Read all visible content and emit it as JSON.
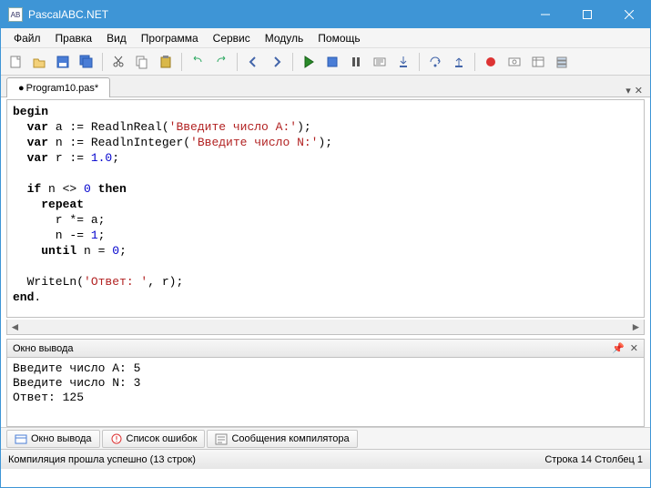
{
  "title": "PascalABC.NET",
  "menu": [
    "Файл",
    "Правка",
    "Вид",
    "Программа",
    "Сервис",
    "Модуль",
    "Помощь"
  ],
  "tab": {
    "label": "Program10.pas*",
    "modified": true
  },
  "code_tokens": [
    [
      {
        "t": "begin",
        "c": "kw"
      }
    ],
    [
      {
        "t": "  "
      },
      {
        "t": "var",
        "c": "kw"
      },
      {
        "t": " a := ReadlnReal("
      },
      {
        "t": "'Введите число A:'",
        "c": "str"
      },
      {
        "t": ");"
      }
    ],
    [
      {
        "t": "  "
      },
      {
        "t": "var",
        "c": "kw"
      },
      {
        "t": " n := ReadlnInteger("
      },
      {
        "t": "'Введите число N:'",
        "c": "str"
      },
      {
        "t": ");"
      }
    ],
    [
      {
        "t": "  "
      },
      {
        "t": "var",
        "c": "kw"
      },
      {
        "t": " r := "
      },
      {
        "t": "1.0",
        "c": "num"
      },
      {
        "t": ";"
      }
    ],
    [
      {
        "t": ""
      }
    ],
    [
      {
        "t": "  "
      },
      {
        "t": "if",
        "c": "kw"
      },
      {
        "t": " n <> "
      },
      {
        "t": "0",
        "c": "num"
      },
      {
        "t": " "
      },
      {
        "t": "then",
        "c": "kw"
      }
    ],
    [
      {
        "t": "    "
      },
      {
        "t": "repeat",
        "c": "kw"
      }
    ],
    [
      {
        "t": "      r *= a;"
      }
    ],
    [
      {
        "t": "      n -= "
      },
      {
        "t": "1",
        "c": "num"
      },
      {
        "t": ";"
      }
    ],
    [
      {
        "t": "    "
      },
      {
        "t": "until",
        "c": "kw"
      },
      {
        "t": " n = "
      },
      {
        "t": "0",
        "c": "num"
      },
      {
        "t": ";"
      }
    ],
    [
      {
        "t": ""
      }
    ],
    [
      {
        "t": "  WriteLn("
      },
      {
        "t": "'Ответ: '",
        "c": "str"
      },
      {
        "t": ", r);"
      }
    ],
    [
      {
        "t": "end",
        "c": "kw"
      },
      {
        "t": "."
      }
    ]
  ],
  "output_panel_title": "Окно вывода",
  "output_lines": [
    "Введите число A: 5",
    "Введите число N: 3",
    "Ответ: 125"
  ],
  "bottom_tabs": [
    "Окно вывода",
    "Список ошибок",
    "Сообщения компилятора"
  ],
  "status_left": "Компиляция прошла успешно (13 строк)",
  "status_right": "Строка  14 Столбец  1",
  "toolbar_icons": [
    "new-file",
    "open-file",
    "save",
    "save-all",
    "sep",
    "cut",
    "copy",
    "paste",
    "sep",
    "undo",
    "redo",
    "sep",
    "nav-back",
    "nav-fwd",
    "sep",
    "run",
    "stop",
    "pause",
    "compile",
    "step-into",
    "sep",
    "step-over",
    "step-out",
    "sep",
    "breakpoint",
    "watch",
    "locals",
    "callstack"
  ]
}
